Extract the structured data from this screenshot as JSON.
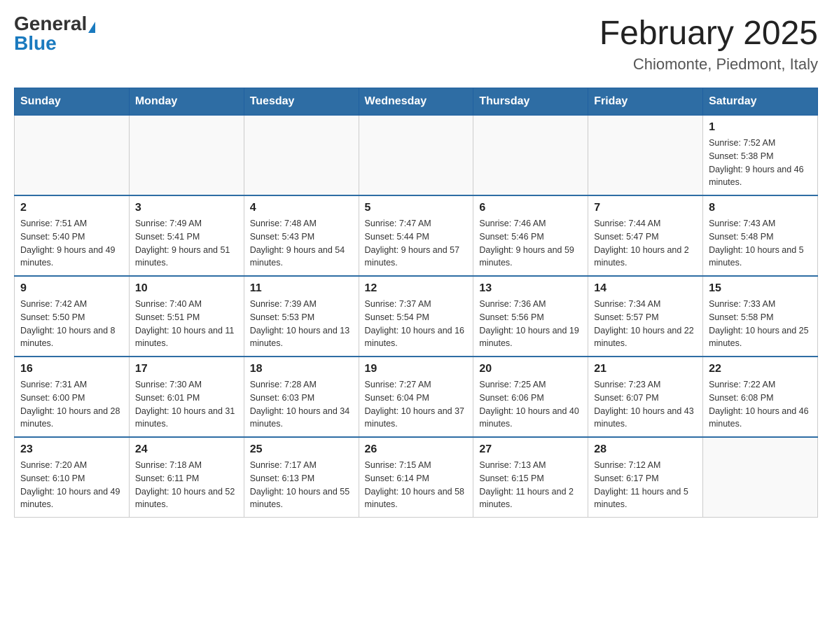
{
  "header": {
    "logo_general": "General",
    "logo_blue": "Blue",
    "month_title": "February 2025",
    "location": "Chiomonte, Piedmont, Italy"
  },
  "days_of_week": [
    "Sunday",
    "Monday",
    "Tuesday",
    "Wednesday",
    "Thursday",
    "Friday",
    "Saturday"
  ],
  "weeks": [
    [
      {
        "day": "",
        "info": ""
      },
      {
        "day": "",
        "info": ""
      },
      {
        "day": "",
        "info": ""
      },
      {
        "day": "",
        "info": ""
      },
      {
        "day": "",
        "info": ""
      },
      {
        "day": "",
        "info": ""
      },
      {
        "day": "1",
        "info": "Sunrise: 7:52 AM\nSunset: 5:38 PM\nDaylight: 9 hours and 46 minutes."
      }
    ],
    [
      {
        "day": "2",
        "info": "Sunrise: 7:51 AM\nSunset: 5:40 PM\nDaylight: 9 hours and 49 minutes."
      },
      {
        "day": "3",
        "info": "Sunrise: 7:49 AM\nSunset: 5:41 PM\nDaylight: 9 hours and 51 minutes."
      },
      {
        "day": "4",
        "info": "Sunrise: 7:48 AM\nSunset: 5:43 PM\nDaylight: 9 hours and 54 minutes."
      },
      {
        "day": "5",
        "info": "Sunrise: 7:47 AM\nSunset: 5:44 PM\nDaylight: 9 hours and 57 minutes."
      },
      {
        "day": "6",
        "info": "Sunrise: 7:46 AM\nSunset: 5:46 PM\nDaylight: 9 hours and 59 minutes."
      },
      {
        "day": "7",
        "info": "Sunrise: 7:44 AM\nSunset: 5:47 PM\nDaylight: 10 hours and 2 minutes."
      },
      {
        "day": "8",
        "info": "Sunrise: 7:43 AM\nSunset: 5:48 PM\nDaylight: 10 hours and 5 minutes."
      }
    ],
    [
      {
        "day": "9",
        "info": "Sunrise: 7:42 AM\nSunset: 5:50 PM\nDaylight: 10 hours and 8 minutes."
      },
      {
        "day": "10",
        "info": "Sunrise: 7:40 AM\nSunset: 5:51 PM\nDaylight: 10 hours and 11 minutes."
      },
      {
        "day": "11",
        "info": "Sunrise: 7:39 AM\nSunset: 5:53 PM\nDaylight: 10 hours and 13 minutes."
      },
      {
        "day": "12",
        "info": "Sunrise: 7:37 AM\nSunset: 5:54 PM\nDaylight: 10 hours and 16 minutes."
      },
      {
        "day": "13",
        "info": "Sunrise: 7:36 AM\nSunset: 5:56 PM\nDaylight: 10 hours and 19 minutes."
      },
      {
        "day": "14",
        "info": "Sunrise: 7:34 AM\nSunset: 5:57 PM\nDaylight: 10 hours and 22 minutes."
      },
      {
        "day": "15",
        "info": "Sunrise: 7:33 AM\nSunset: 5:58 PM\nDaylight: 10 hours and 25 minutes."
      }
    ],
    [
      {
        "day": "16",
        "info": "Sunrise: 7:31 AM\nSunset: 6:00 PM\nDaylight: 10 hours and 28 minutes."
      },
      {
        "day": "17",
        "info": "Sunrise: 7:30 AM\nSunset: 6:01 PM\nDaylight: 10 hours and 31 minutes."
      },
      {
        "day": "18",
        "info": "Sunrise: 7:28 AM\nSunset: 6:03 PM\nDaylight: 10 hours and 34 minutes."
      },
      {
        "day": "19",
        "info": "Sunrise: 7:27 AM\nSunset: 6:04 PM\nDaylight: 10 hours and 37 minutes."
      },
      {
        "day": "20",
        "info": "Sunrise: 7:25 AM\nSunset: 6:06 PM\nDaylight: 10 hours and 40 minutes."
      },
      {
        "day": "21",
        "info": "Sunrise: 7:23 AM\nSunset: 6:07 PM\nDaylight: 10 hours and 43 minutes."
      },
      {
        "day": "22",
        "info": "Sunrise: 7:22 AM\nSunset: 6:08 PM\nDaylight: 10 hours and 46 minutes."
      }
    ],
    [
      {
        "day": "23",
        "info": "Sunrise: 7:20 AM\nSunset: 6:10 PM\nDaylight: 10 hours and 49 minutes."
      },
      {
        "day": "24",
        "info": "Sunrise: 7:18 AM\nSunset: 6:11 PM\nDaylight: 10 hours and 52 minutes."
      },
      {
        "day": "25",
        "info": "Sunrise: 7:17 AM\nSunset: 6:13 PM\nDaylight: 10 hours and 55 minutes."
      },
      {
        "day": "26",
        "info": "Sunrise: 7:15 AM\nSunset: 6:14 PM\nDaylight: 10 hours and 58 minutes."
      },
      {
        "day": "27",
        "info": "Sunrise: 7:13 AM\nSunset: 6:15 PM\nDaylight: 11 hours and 2 minutes."
      },
      {
        "day": "28",
        "info": "Sunrise: 7:12 AM\nSunset: 6:17 PM\nDaylight: 11 hours and 5 minutes."
      },
      {
        "day": "",
        "info": ""
      }
    ]
  ]
}
